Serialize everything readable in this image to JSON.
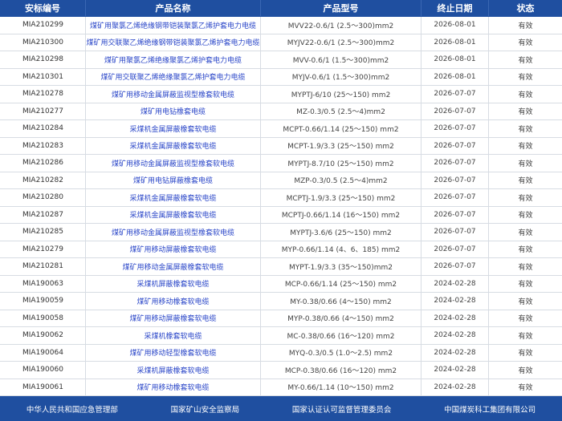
{
  "header": {
    "cert_no": "安标编号",
    "product_name": "产品名称",
    "model": "产品型号",
    "expiry": "终止日期",
    "status": "状态"
  },
  "rows": [
    {
      "cert_no": "MIA210299",
      "product_name": "煤矿用聚氯乙烯绝缘钢带铠装聚氯乙烯护套电力电缆",
      "model": "MVV22-0.6/1 (2.5～300)mm2",
      "expiry": "2026-08-01",
      "status": "有效"
    },
    {
      "cert_no": "MIA210300",
      "product_name": "煤矿用交联聚乙烯绝缘钢带铠装聚氯乙烯护套电力电缆",
      "model": "MYJV22-0.6/1 (2.5～300)mm2",
      "expiry": "2026-08-01",
      "status": "有效"
    },
    {
      "cert_no": "MIA210298",
      "product_name": "煤矿用聚氯乙烯绝缘聚氯乙烯护套电力电缆",
      "model": "MVV-0.6/1 (1.5～300)mm2",
      "expiry": "2026-08-01",
      "status": "有效"
    },
    {
      "cert_no": "MIA210301",
      "product_name": "煤矿用交联聚乙烯绝缘聚氯乙烯护套电力电缆",
      "model": "MYJV-0.6/1 (1.5～300)mm2",
      "expiry": "2026-08-01",
      "status": "有效"
    },
    {
      "cert_no": "MIA210278",
      "product_name": "煤矿用移动金属屏蔽监视型橡套软电缆",
      "model": "MYPTJ-6/10 (25～150) mm2",
      "expiry": "2026-07-07",
      "status": "有效"
    },
    {
      "cert_no": "MIA210277",
      "product_name": "煤矿用电钻橡套电缆",
      "model": "MZ-0.3/0.5 (2.5～4)mm2",
      "expiry": "2026-07-07",
      "status": "有效"
    },
    {
      "cert_no": "MIA210284",
      "product_name": "采煤机金属屏蔽橡套软电缆",
      "model": "MCPT-0.66/1.14 (25～150) mm2",
      "expiry": "2026-07-07",
      "status": "有效"
    },
    {
      "cert_no": "MIA210283",
      "product_name": "采煤机金属屏蔽橡套软电缆",
      "model": "MCPT-1.9/3.3 (25～150) mm2",
      "expiry": "2026-07-07",
      "status": "有效"
    },
    {
      "cert_no": "MIA210286",
      "product_name": "煤矿用移动金属屏蔽监视型橡套软电缆",
      "model": "MYPTJ-8.7/10 (25～150) mm2",
      "expiry": "2026-07-07",
      "status": "有效"
    },
    {
      "cert_no": "MIA210282",
      "product_name": "煤矿用电钻屏蔽橡套电缆",
      "model": "MZP-0.3/0.5 (2.5～4)mm2",
      "expiry": "2026-07-07",
      "status": "有效"
    },
    {
      "cert_no": "MIA210280",
      "product_name": "采煤机金属屏蔽橡套软电缆",
      "model": "MCPTJ-1.9/3.3 (25～150) mm2",
      "expiry": "2026-07-07",
      "status": "有效"
    },
    {
      "cert_no": "MIA210287",
      "product_name": "采煤机金属屏蔽橡套软电缆",
      "model": "MCPTJ-0.66/1.14 (16～150) mm2",
      "expiry": "2026-07-07",
      "status": "有效"
    },
    {
      "cert_no": "MIA210285",
      "product_name": "煤矿用移动金属屏蔽监视型橡套软电缆",
      "model": "MYPTJ-3.6/6 (25～150) mm2",
      "expiry": "2026-07-07",
      "status": "有效"
    },
    {
      "cert_no": "MIA210279",
      "product_name": "煤矿用移动屏蔽橡套软电缆",
      "model": "MYP-0.66/1.14 (4、6、185) mm2",
      "expiry": "2026-07-07",
      "status": "有效"
    },
    {
      "cert_no": "MIA210281",
      "product_name": "煤矿用移动金属屏蔽橡套软电缆",
      "model": "MYPT-1.9/3.3 (35～150)mm2",
      "expiry": "2026-07-07",
      "status": "有效"
    },
    {
      "cert_no": "MIA190063",
      "product_name": "采煤机屏蔽橡套软电缆",
      "model": "MCP-0.66/1.14 (25～150) mm2",
      "expiry": "2024-02-28",
      "status": "有效"
    },
    {
      "cert_no": "MIA190059",
      "product_name": "煤矿用移动橡套软电缆",
      "model": "MY-0.38/0.66 (4～150) mm2",
      "expiry": "2024-02-28",
      "status": "有效"
    },
    {
      "cert_no": "MIA190058",
      "product_name": "煤矿用移动屏蔽橡套软电缆",
      "model": "MYP-0.38/0.66 (4～150) mm2",
      "expiry": "2024-02-28",
      "status": "有效"
    },
    {
      "cert_no": "MIA190062",
      "product_name": "采煤机橡套软电缆",
      "model": "MC-0.38/0.66 (16～120) mm2",
      "expiry": "2024-02-28",
      "status": "有效"
    },
    {
      "cert_no": "MIA190064",
      "product_name": "煤矿用移动轻型橡套软电缆",
      "model": "MYQ-0.3/0.5 (1.0～2.5) mm2",
      "expiry": "2024-02-28",
      "status": "有效"
    },
    {
      "cert_no": "MIA190060",
      "product_name": "采煤机屏蔽橡套软电缆",
      "model": "MCP-0.38/0.66 (16～120) mm2",
      "expiry": "2024-02-28",
      "status": "有效"
    },
    {
      "cert_no": "MIA190061",
      "product_name": "煤矿用移动橡套软电缆",
      "model": "MY-0.66/1.14 (10～150) mm2",
      "expiry": "2024-02-28",
      "status": "有效"
    }
  ],
  "footer": {
    "links": [
      "中华人民共和国应急管理部",
      "国家矿山安全监察局",
      "国家认证认可监督管理委员会",
      "中国煤炭科工集团有限公司"
    ]
  },
  "colors": {
    "header_bg": "#1f4fa0",
    "link": "#2a46c8",
    "border": "#d7dce3"
  }
}
